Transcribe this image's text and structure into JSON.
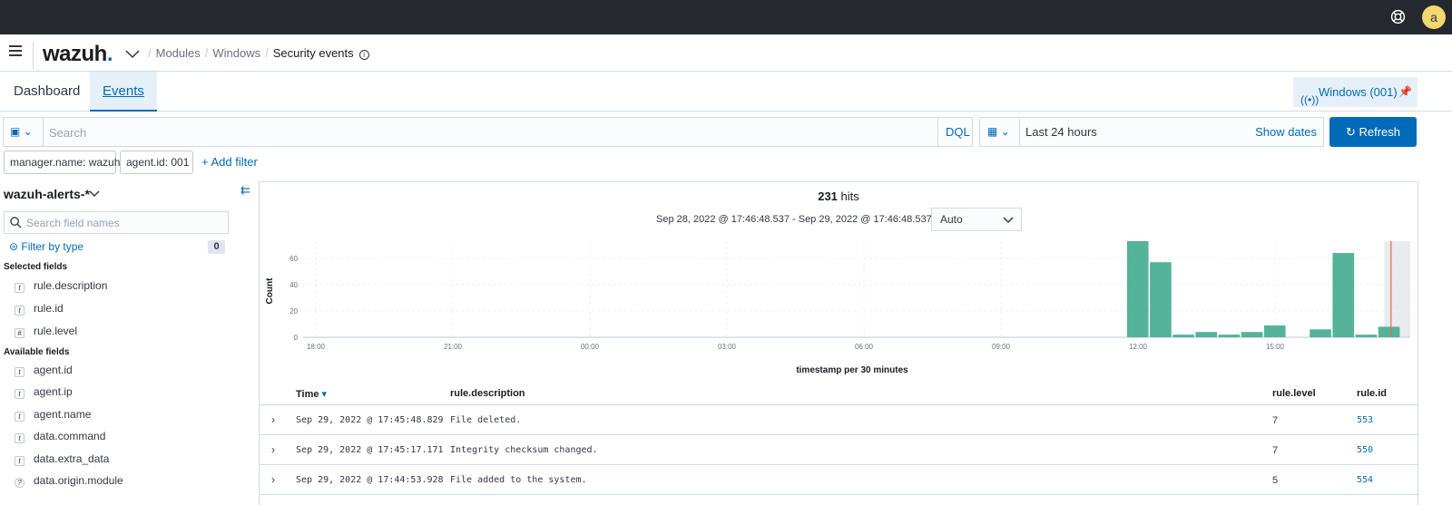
{
  "topbar": {
    "avatar": "a",
    "help_icon": "help-icon"
  },
  "header": {
    "logo": "wazuh",
    "logo_dot": ".",
    "breadcrumbs": [
      "Modules",
      "Windows",
      "Security events"
    ]
  },
  "tabs": [
    {
      "label": "Dashboard",
      "active": false
    },
    {
      "label": "Events",
      "active": true
    }
  ],
  "agent_pill": {
    "label": "Windows (001)"
  },
  "search": {
    "placeholder": "Search",
    "value": "",
    "dql": "DQL"
  },
  "date": {
    "range": "Last 24 hours",
    "show_dates": "Show dates",
    "refresh": "Refresh"
  },
  "filters": [
    {
      "label": "manager.name: wazuh"
    },
    {
      "label": "agent.id: 001"
    }
  ],
  "add_filter": "+ Add filter",
  "sidebar": {
    "index_pattern": "wazuh-alerts-*",
    "search_placeholder": "Search field names",
    "filter_by_type": "Filter by type",
    "filter_count": "0",
    "selected_label": "Selected fields",
    "selected": [
      {
        "type": "t",
        "name": "rule.description"
      },
      {
        "type": "t",
        "name": "rule.id"
      },
      {
        "type": "#",
        "name": "rule.level"
      }
    ],
    "available_label": "Available fields",
    "available": [
      {
        "type": "t",
        "name": "agent.id"
      },
      {
        "type": "t",
        "name": "agent.ip"
      },
      {
        "type": "t",
        "name": "agent.name"
      },
      {
        "type": "t",
        "name": "data.command"
      },
      {
        "type": "t",
        "name": "data.extra_data"
      },
      {
        "type": "?",
        "name": "data.origin.module"
      }
    ]
  },
  "hits": {
    "count": "231",
    "label": "hits"
  },
  "period": "Sep 28, 2022 @ 17:46:48.537 - Sep 29, 2022 @ 17:46:48.537",
  "interval": "Auto",
  "chart_data": {
    "type": "bar",
    "ylabel": "Count",
    "xlabel": "timestamp per 30 minutes",
    "x_ticks": [
      "18:00",
      "21:00",
      "00:00",
      "03:00",
      "06:00",
      "09:00",
      "12:00",
      "15:00"
    ],
    "y_ticks": [
      0,
      20,
      40,
      60
    ],
    "ylim": [
      0,
      73
    ],
    "bars": [
      {
        "slot": 36,
        "value": 73
      },
      {
        "slot": 37,
        "value": 57
      },
      {
        "slot": 38,
        "value": 2
      },
      {
        "slot": 39,
        "value": 4
      },
      {
        "slot": 40,
        "value": 2
      },
      {
        "slot": 41,
        "value": 4
      },
      {
        "slot": 42,
        "value": 9
      },
      {
        "slot": 44,
        "value": 6
      },
      {
        "slot": 45,
        "value": 64
      },
      {
        "slot": 46,
        "value": 2
      },
      {
        "slot": 47,
        "value": 8
      }
    ],
    "bar_color": "#54b399"
  },
  "table": {
    "headers": [
      "Time",
      "rule.description",
      "rule.level",
      "rule.id"
    ],
    "rows": [
      {
        "time": "Sep 29, 2022 @ 17:45:48.829",
        "description": "File deleted.",
        "level": "7",
        "id": "553"
      },
      {
        "time": "Sep 29, 2022 @ 17:45:17.171",
        "description": "Integrity checksum changed.",
        "level": "7",
        "id": "550"
      },
      {
        "time": "Sep 29, 2022 @ 17:44:53.928",
        "description": "File added to the system.",
        "level": "5",
        "id": "554"
      }
    ]
  }
}
